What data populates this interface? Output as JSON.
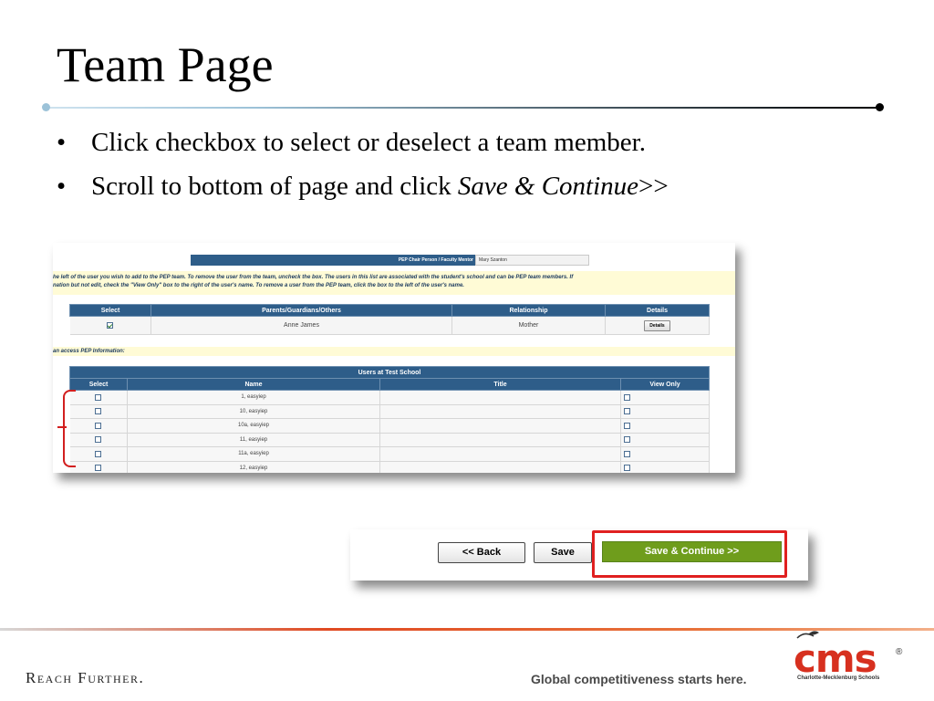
{
  "slide": {
    "title": "Team Page",
    "bullets": [
      {
        "text": "Click checkbox to select or deselect a team member.",
        "emphasis": ""
      },
      {
        "text": "Scroll to bottom of page and click ",
        "emphasis": "Save & Continue",
        "suffix": ">>"
      }
    ]
  },
  "screenshot1": {
    "mentor_label": "PEP Chair Person / Faculty Mentor",
    "mentor_value": "Mary Szanton",
    "instructions_line1": "he left of the user you wish to add to the PEP team. To remove the user from the team, uncheck the box. The users in this list are associated with the student's school and can be PEP team members. If",
    "instructions_line2": "nation but not edit, check the \"View Only\" box to the right of the user's name. To remove a user from the PEP team, click the box to the left of the user's name.",
    "parents_table": {
      "headers": [
        "Select",
        "Parents/Guardians/Others",
        "Relationship",
        "Details"
      ],
      "rows": [
        {
          "selected": true,
          "name": "Anne James",
          "relationship": "Mother",
          "details_label": "Details"
        }
      ]
    },
    "pep_access_label": "an access PEP Information:",
    "users_table": {
      "caption": "Users at Test School",
      "headers": [
        "Select",
        "Name",
        "Title",
        "View Only"
      ],
      "rows": [
        {
          "name": "1, easyiep",
          "title": ""
        },
        {
          "name": "10, easyiep",
          "title": ""
        },
        {
          "name": "10a, easyiep",
          "title": ""
        },
        {
          "name": "11, easyiep",
          "title": ""
        },
        {
          "name": "11a, easyiep",
          "title": ""
        },
        {
          "name": "12, easyiep",
          "title": ""
        }
      ]
    }
  },
  "screenshot2": {
    "back_label": "<< Back",
    "save_label": "Save",
    "continue_label": "Save & Continue >>"
  },
  "footer": {
    "left": "Reach Further.",
    "tagline": "Global competitiveness starts here.",
    "logo_text": "cms",
    "logo_sub": "Charlotte-Mecklenburg Schools"
  },
  "colors": {
    "header_blue": "#2e5d89",
    "continue_green": "#6f9d1c",
    "highlight_red": "#e02020",
    "info_yellow": "#fffbd6"
  }
}
